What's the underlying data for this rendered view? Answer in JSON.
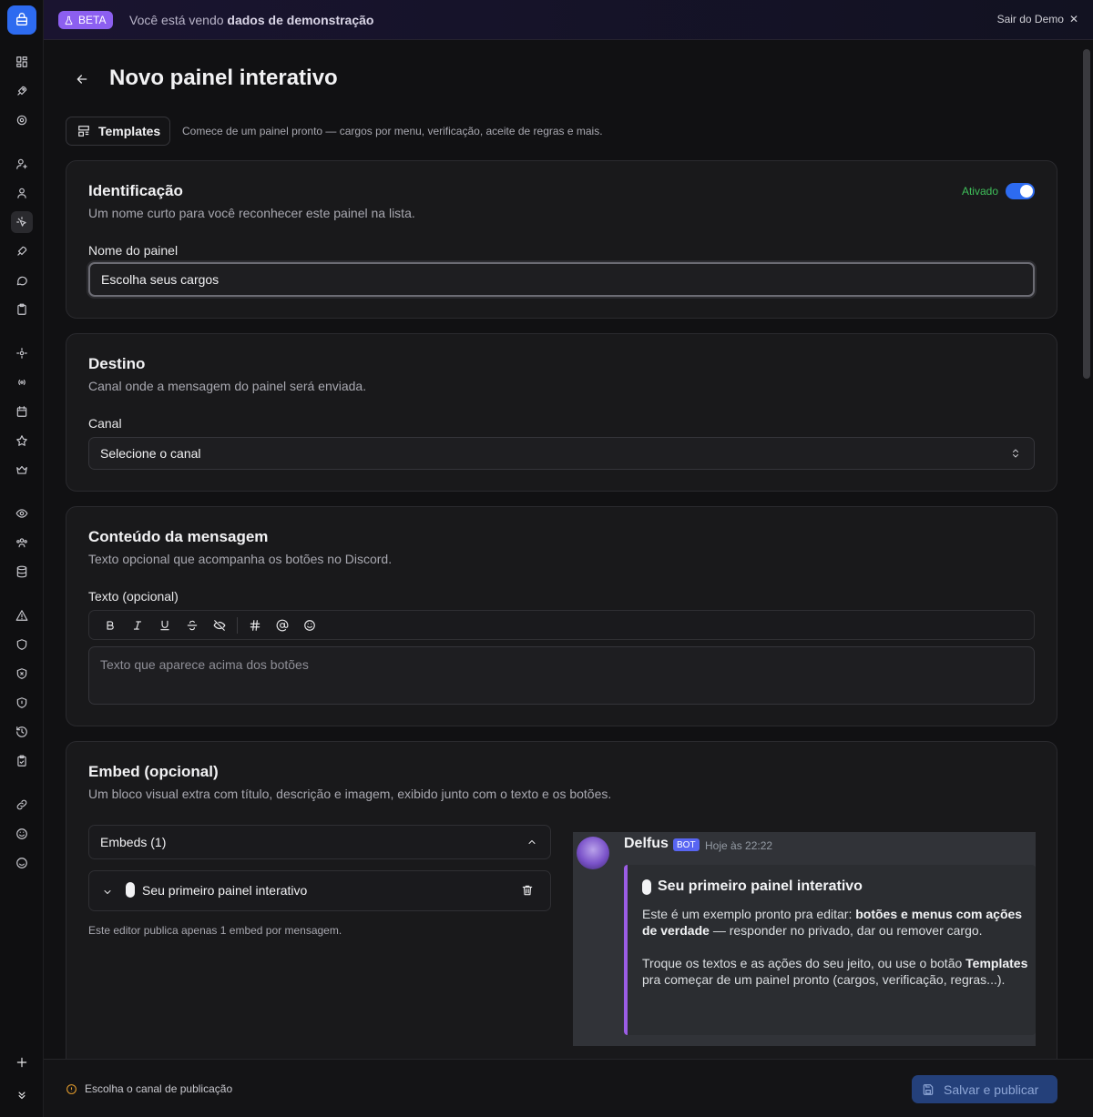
{
  "banner": {
    "beta_label": "BETA",
    "demo_prefix": "Você está vendo",
    "demo_bold": "dados de demonstração",
    "exit_label": "Sair do Demo"
  },
  "sidebar": {
    "icons": [
      "dashboard-icon",
      "rocket-icon",
      "settings-icon",
      "user-plus-icon",
      "user-icon",
      "pointer-click-icon",
      "rocket-icon",
      "message-icon",
      "clipboard-icon",
      "settings-cog-icon",
      "broadcast-icon",
      "calendar-icon",
      "star-icon",
      "crown-icon",
      "eye-icon",
      "users-icon",
      "database-icon",
      "alert-icon",
      "shield-refresh-icon",
      "shield-x-icon",
      "shield-icon",
      "history-icon",
      "clipboard-check-icon",
      "link-icon",
      "smile-icon",
      "smile-plus-icon"
    ]
  },
  "page": {
    "title": "Novo painel interativo"
  },
  "templates": {
    "button_label": "Templates",
    "hint": "Comece de um painel pronto — cargos por menu, verificação, aceite de regras e mais."
  },
  "identificacao": {
    "title": "Identificação",
    "description": "Um nome curto para você reconhecer este painel na lista.",
    "toggle_label": "Ativado",
    "toggle_on": true,
    "field_label": "Nome do painel",
    "field_value": "Escolha seus cargos"
  },
  "destino": {
    "title": "Destino",
    "description": "Canal onde a mensagem do painel será enviada.",
    "field_label": "Canal",
    "select_value": "Selecione o canal"
  },
  "conteudo": {
    "title": "Conteúdo da mensagem",
    "description": "Texto opcional que acompanha os botões no Discord.",
    "field_label": "Texto (opcional)",
    "toolbar": [
      "bold",
      "italic",
      "underline",
      "strikethrough",
      "spoiler",
      "channel",
      "mention",
      "emoji"
    ],
    "placeholder": "Texto que aparece acima dos botões"
  },
  "embed": {
    "title": "Embed (opcional)",
    "description": "Um bloco visual extra com título, descrição e imagem, exibido junto com o texto e os botões.",
    "list_label": "Embeds (1)",
    "item_name": "Seu primeiro painel interativo",
    "note": "Este editor publica apenas 1 embed por mensagem."
  },
  "preview": {
    "bot_name": "Delfus",
    "bot_tag": "BOT",
    "time": "Hoje às 22:22",
    "embed_title": "Seu primeiro painel interativo",
    "p1_a": "Este é um exemplo pronto pra editar: ",
    "p1_b": "botões e menus com ações de verdade",
    "p1_c": " — responder no privado, dar ou remover cargo.",
    "p2_a": "Troque os textos e as ações do seu jeito, ou use o botão ",
    "p2_b": "Templates",
    "p2_c": " pra começar de um painel pronto (cargos, verificação, regras...).",
    "accent_color": "#9b5de5"
  },
  "footer": {
    "warning": "Escolha o canal de publicação",
    "save_label": "Salvar e publicar"
  },
  "colors": {
    "accent": "#2d6bf0",
    "beta": "#8c5ff0",
    "active_green": "#3fbf5a"
  }
}
